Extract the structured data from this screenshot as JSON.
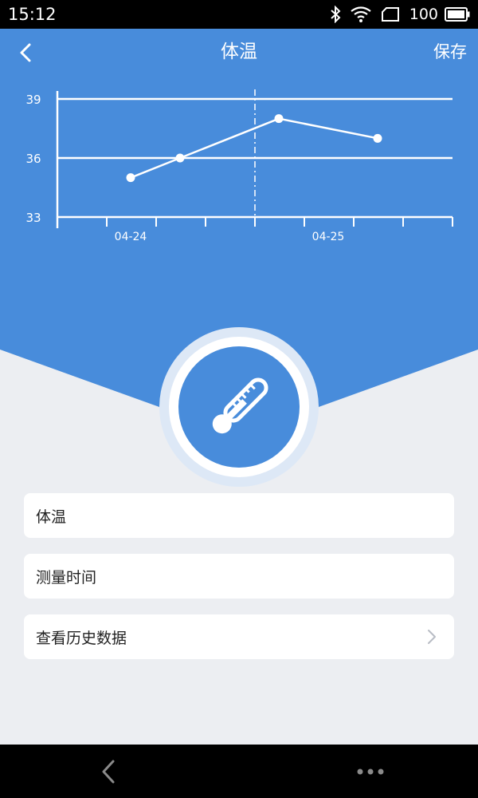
{
  "status_bar": {
    "time": "15:12",
    "battery": "100",
    "icons": [
      "bluetooth-icon",
      "wifi-icon",
      "sim-icon",
      "battery-icon"
    ]
  },
  "header": {
    "title": "体温",
    "save_label": "保存",
    "back_icon": "chevron-left-icon"
  },
  "chart_data": {
    "type": "line",
    "y_ticks": [
      "39",
      "36",
      "33"
    ],
    "ylim": [
      33,
      39
    ],
    "x_labels": [
      "04-24",
      "04-25"
    ],
    "points": [
      {
        "x": 0.0,
        "y": 35
      },
      {
        "x": 0.25,
        "y": 36
      },
      {
        "x": 0.75,
        "y": 38
      },
      {
        "x": 1.25,
        "y": 37
      }
    ],
    "grid": true,
    "line_color": "#ffffff"
  },
  "badge": {
    "icon": "thermometer-icon"
  },
  "list": {
    "items": [
      {
        "label": "体温"
      },
      {
        "label": "测量时间"
      },
      {
        "label": "查看历史数据",
        "icon": "chevron-right-icon"
      }
    ]
  },
  "nav": {
    "back_icon": "chevron-left-icon",
    "more_icon": "more-dots-icon"
  },
  "colors": {
    "primary": "#488cdb",
    "background": "#eceef2",
    "card": "#ffffff"
  }
}
